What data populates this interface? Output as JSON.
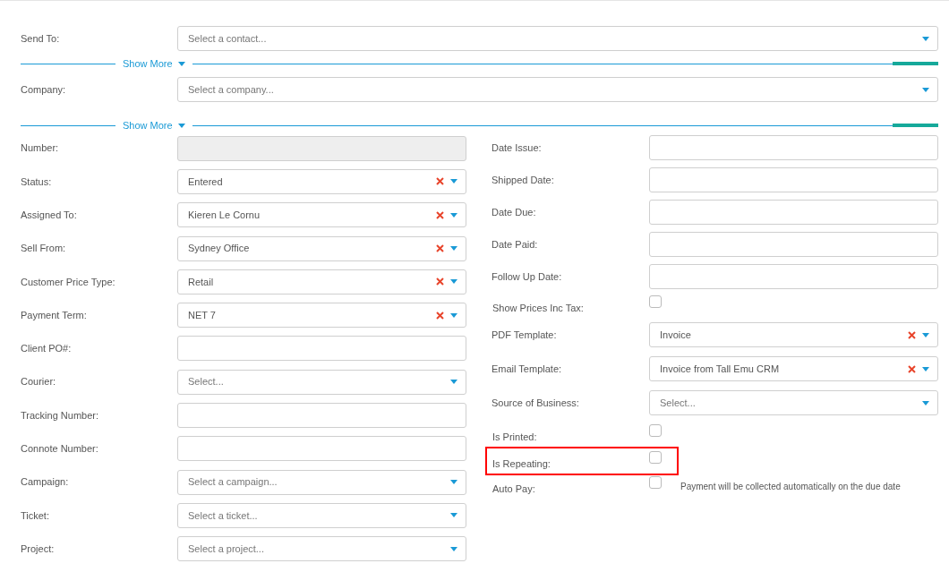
{
  "top_rows": [
    {
      "kind": "select",
      "label": "Send To:",
      "placeholder": "Select a contact..."
    },
    {
      "kind": "show_more",
      "label": "Show More"
    },
    {
      "kind": "select",
      "label": "Company:",
      "placeholder": "Select a company..."
    },
    {
      "kind": "show_more",
      "label": "Show More"
    }
  ],
  "left_fields": [
    {
      "kind": "input",
      "label": "Number:",
      "disabled": true
    },
    {
      "kind": "select",
      "label": "Status:",
      "value": "Entered",
      "clearable": true
    },
    {
      "kind": "select",
      "label": "Assigned To:",
      "value": "Kieren Le Cornu",
      "clearable": true
    },
    {
      "kind": "select",
      "label": "Sell From:",
      "value": "Sydney Office",
      "clearable": true
    },
    {
      "kind": "select",
      "label": "Customer Price Type:",
      "value": "Retail",
      "clearable": true
    },
    {
      "kind": "select",
      "label": "Payment Term:",
      "value": "NET 7",
      "clearable": true
    },
    {
      "kind": "input",
      "label": "Client PO#:",
      "disabled": false
    },
    {
      "kind": "select",
      "label": "Courier:",
      "placeholder": "Select...",
      "clearable": false
    },
    {
      "kind": "input",
      "label": "Tracking Number:",
      "disabled": false
    },
    {
      "kind": "input",
      "label": "Connote Number:",
      "disabled": false
    },
    {
      "kind": "select",
      "label": "Campaign:",
      "placeholder": "Select a campaign...",
      "clearable": false
    },
    {
      "kind": "select",
      "label": "Ticket:",
      "placeholder": "Select a ticket...",
      "clearable": false
    },
    {
      "kind": "select",
      "label": "Project:",
      "placeholder": "Select a project...",
      "clearable": false
    }
  ],
  "right_fields": [
    {
      "kind": "input",
      "label": "Date Issue:",
      "disabled": false
    },
    {
      "kind": "input",
      "label": "Shipped Date:",
      "disabled": false
    },
    {
      "kind": "input",
      "label": "Date Due:",
      "disabled": false
    },
    {
      "kind": "input",
      "label": "Date Paid:",
      "disabled": false
    },
    {
      "kind": "input",
      "label": "Follow Up Date:",
      "disabled": false
    },
    {
      "kind": "checkbox",
      "label": "Show Prices Inc Tax:",
      "checked": false,
      "highlighted": false
    },
    {
      "kind": "select",
      "label": "PDF Template:",
      "value": "Invoice",
      "clearable": true
    },
    {
      "kind": "select",
      "label": "Email Template:",
      "value": "Invoice from Tall Emu CRM",
      "clearable": true
    },
    {
      "kind": "select",
      "label": "Source of Business:",
      "placeholder": "Select...",
      "clearable": false
    },
    {
      "kind": "checkbox",
      "label": "Is Printed:",
      "checked": false,
      "highlighted": false
    },
    {
      "kind": "checkbox",
      "label": "Is Repeating:",
      "checked": false,
      "highlighted": true
    },
    {
      "kind": "checkbox",
      "label": "Auto Pay:",
      "checked": false,
      "highlighted": false,
      "note": "Payment will be collected automatically on the due date"
    }
  ]
}
